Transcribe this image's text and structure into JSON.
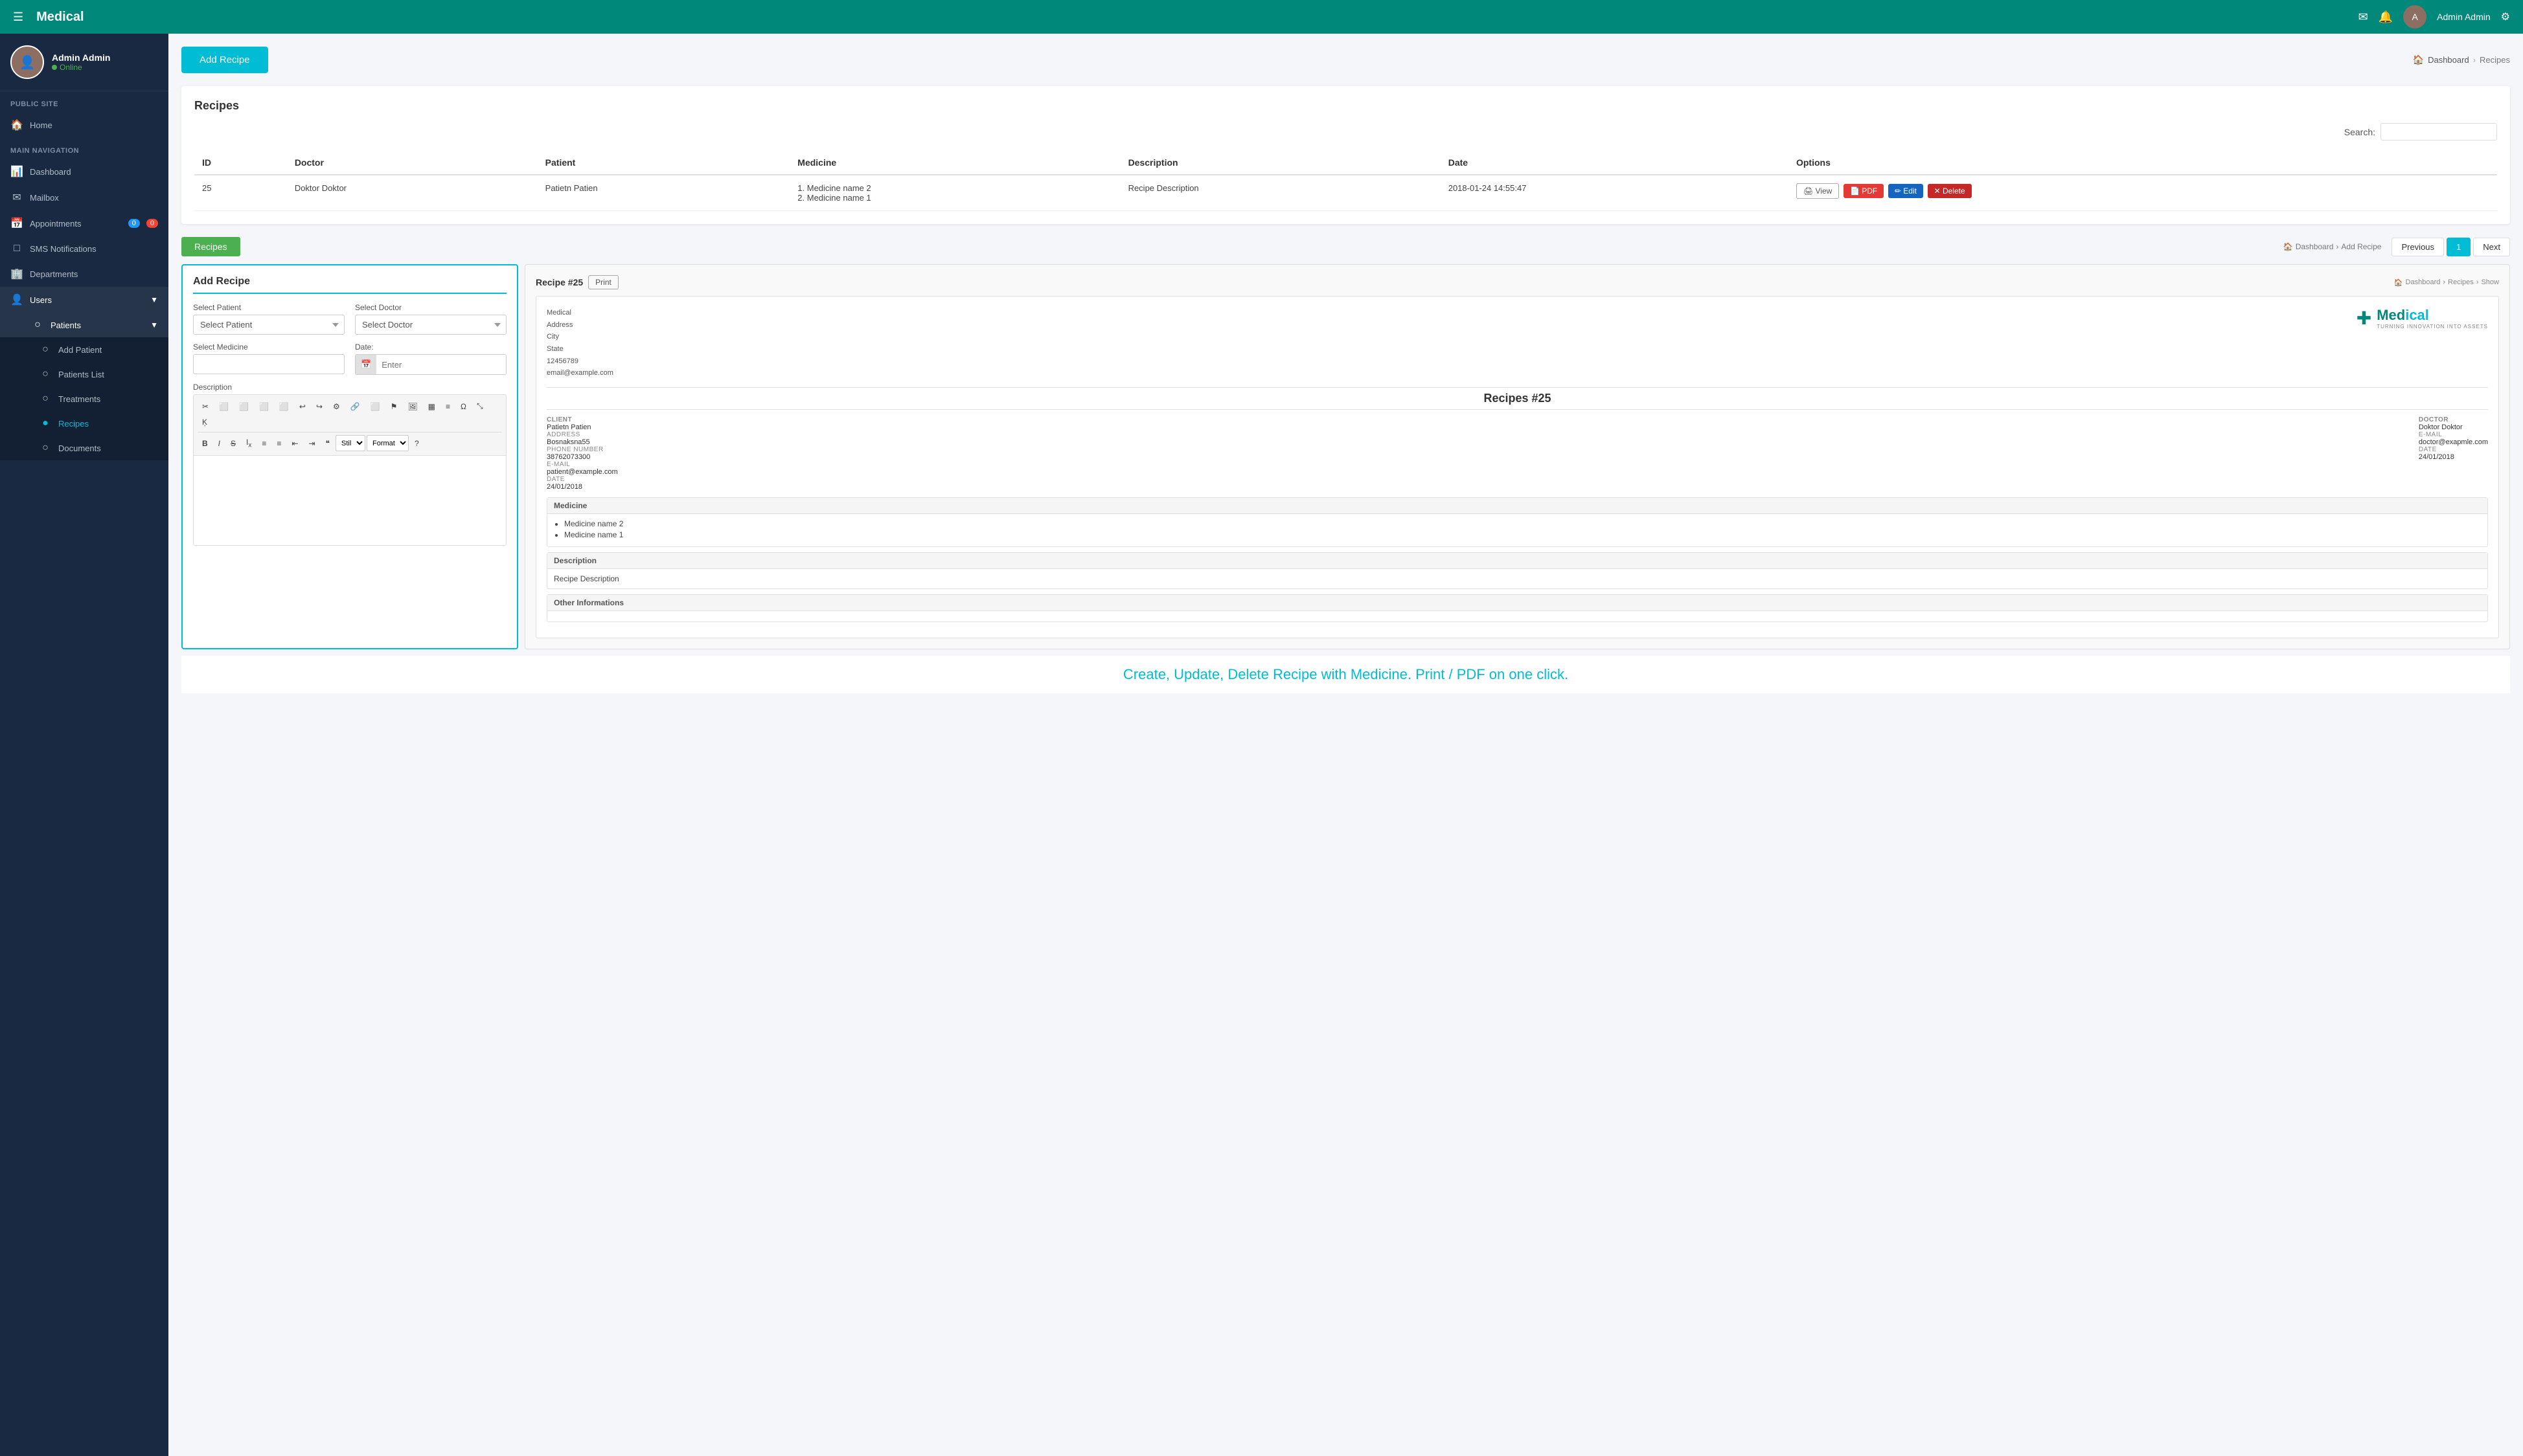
{
  "app": {
    "brand": "Medical",
    "topbar": {
      "menu_icon": "☰",
      "username": "Admin Admin",
      "settings_icon": "⚙"
    }
  },
  "sidebar": {
    "user": {
      "name": "Admin Admin",
      "status": "Online"
    },
    "sections": [
      {
        "label": "PUBLIC SITE",
        "items": [
          {
            "icon": "🏠",
            "label": "Home",
            "active": false
          }
        ]
      },
      {
        "label": "MAIN NAVIGATION",
        "items": [
          {
            "icon": "📊",
            "label": "Dashboard",
            "active": false
          },
          {
            "icon": "✉",
            "label": "Mailbox",
            "active": false
          },
          {
            "icon": "📅",
            "label": "Appointments",
            "active": false,
            "badge1": "0",
            "badge2": "0"
          },
          {
            "icon": "□",
            "label": "SMS Notifications",
            "active": false
          },
          {
            "icon": "🏢",
            "label": "Departments",
            "active": false
          },
          {
            "icon": "👤",
            "label": "Users",
            "active": false,
            "arrow": true
          }
        ]
      }
    ],
    "submenu": {
      "label": "Patients",
      "items": [
        {
          "label": "Add Patient",
          "active": false
        },
        {
          "label": "Patients List",
          "active": false
        },
        {
          "label": "Treatments",
          "active": false
        },
        {
          "label": "Recipes",
          "active": true
        },
        {
          "label": "Documents",
          "active": false
        }
      ]
    }
  },
  "header": {
    "add_recipe_btn": "Add Recipe",
    "breadcrumb": {
      "dashboard": "Dashboard",
      "current": "Recipes"
    }
  },
  "recipes_page": {
    "title": "Recipes",
    "search_label": "Search:",
    "search_placeholder": "",
    "table": {
      "columns": [
        "ID",
        "Doctor",
        "Patient",
        "Medicine",
        "Description",
        "Date",
        "Options"
      ],
      "rows": [
        {
          "id": "25",
          "doctor": "Doktor Doktor",
          "patient": "Patietn Patien",
          "medicines": [
            "1. Medicine name 2",
            "2. Medicine name 1"
          ],
          "description": "Recipe Description",
          "date": "2018-01-24 14:55:47",
          "options": {
            "view": "View",
            "pdf": "PDF",
            "edit": "Edit",
            "delete": "Delete"
          }
        }
      ]
    }
  },
  "modal": {
    "recipes_tab": "Recipes",
    "breadcrumb": {
      "dashboard": "Dashboard",
      "add_recipe": "Add Recipe"
    },
    "pagination": {
      "previous": "Previous",
      "page": "1",
      "next": "Next"
    },
    "form": {
      "title": "Add Recipe",
      "select_patient_label": "Select Patient",
      "select_patient_placeholder": "Select Patient",
      "select_doctor_label": "Select Doctor",
      "select_doctor_placeholder": "Select Doctor",
      "select_medicine_label": "Select Medicine",
      "date_label": "Date:",
      "date_placeholder": "Enter",
      "description_label": "Description",
      "format_label": "Format",
      "style_label": "Stil",
      "toolbar_buttons": [
        "✂",
        "⬜",
        "⬜",
        "⬜",
        "⬜",
        "↩",
        "↪",
        "⚙",
        "🔗",
        "⬜",
        "⚑",
        "🖼",
        "▦",
        "≡",
        "Ω",
        "⤡",
        "Ķ"
      ],
      "format_btn": "Format",
      "style_btn": "Stil",
      "help_btn": "?"
    },
    "preview": {
      "title": "Recipe #25",
      "print_btn": "Print",
      "breadcrumb": {
        "dashboard": "Dashboard",
        "recipes": "Recipes",
        "show": "Show"
      },
      "clinic": {
        "name": "Medical",
        "address_label": "Address",
        "city_label": "City",
        "state_label": "State",
        "phone": "12456789",
        "email": "email@example.com"
      },
      "logo_text_part1": "Med",
      "logo_text_part2": "ical",
      "logo_subtitle": "Turning Innovation Into Assets",
      "recipe_title": "Recipes #25",
      "client": {
        "name": "Patietn Patien",
        "address": "Bosnaksna55",
        "phone": "38762073300",
        "email": "patient@example.com",
        "date": "24/01/2018"
      },
      "doctor": {
        "name": "Doktor Doktor",
        "email": "doctor@exapmle.com",
        "date": "24/01/2018"
      },
      "medicine_section": "Medicine",
      "medicines": [
        "Medicine name 2",
        "Medicine name 1"
      ],
      "description_section": "Description",
      "description": "Recipe Description",
      "other_info_section": "Other Informations"
    }
  },
  "bottom_tagline": "Create, Update, Delete Recipe with Medicine. Print / PDF on one click."
}
